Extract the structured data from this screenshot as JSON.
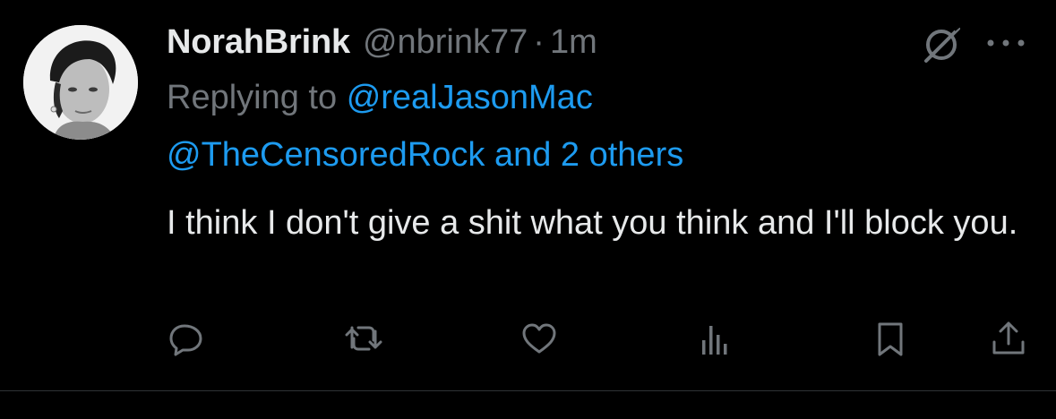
{
  "tweet": {
    "author_name": "NorahBrink",
    "handle": "@nbrink77",
    "separator": "·",
    "time": "1m",
    "replying_prefix": "Replying to",
    "replying_to_primary": "@realJasonMac",
    "replying_to_secondary": "@TheCensoredRock and 2 others",
    "text": "I think I don't give a shit what you think and I'll block you."
  },
  "icons": {
    "header": [
      "grok-icon",
      "more-options-icon"
    ],
    "actions": [
      "reply-icon",
      "retweet-icon",
      "like-icon",
      "views-icon",
      "bookmark-icon",
      "share-icon"
    ]
  },
  "colors": {
    "background": "#000000",
    "primary_text": "#e7e9ea",
    "secondary_text": "#71767b",
    "link": "#1d9bf0",
    "divider": "#2f3336"
  }
}
